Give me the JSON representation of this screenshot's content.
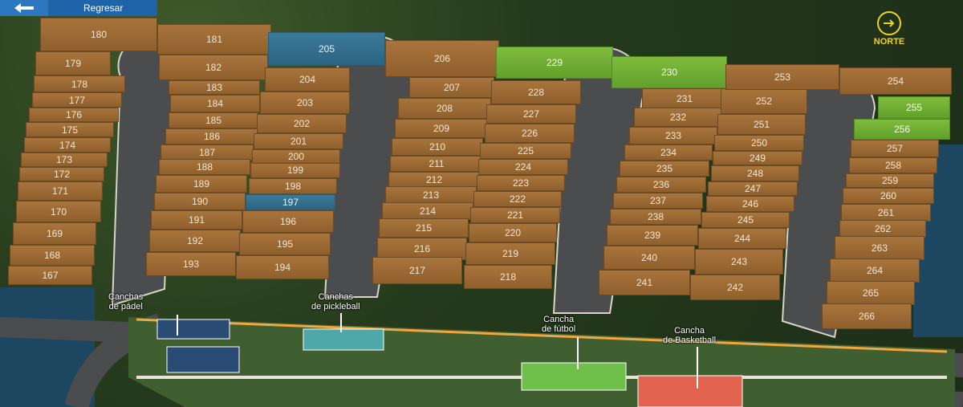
{
  "nav": {
    "back_label": "Regresar"
  },
  "compass": {
    "label": "NORTE",
    "icon": "arrow-right-icon"
  },
  "amenities": [
    {
      "id": "padel",
      "line1": "Canchas",
      "line2": "de pádel"
    },
    {
      "id": "pickleball",
      "line1": "Canchas",
      "line2": "de pickleball"
    },
    {
      "id": "futbol",
      "line1": "Cancha",
      "line2": "de fútbol"
    },
    {
      "id": "basketball",
      "line1": "Cancha",
      "line2": "de Basketball"
    }
  ],
  "lot_colors": {
    "available": "#9c6a35",
    "sold": "#3c7a99",
    "reserved": "#76b33a"
  },
  "lots": {
    "167": "sold",
    "168": "sold",
    "169": "sold",
    "170": "sold",
    "171": "sold",
    "172": "sold",
    "173": "sold",
    "174": "sold",
    "175": "sold",
    "176": "sold",
    "177": "sold",
    "178": "sold",
    "179": "sold",
    "180": "sold",
    "181": "sold",
    "182": "sold",
    "183": "sold",
    "184": "sold",
    "185": "sold",
    "186": "sold",
    "187": "sold",
    "188": "sold",
    "189": "sold",
    "190": "sold",
    "191": "sold",
    "192": "sold",
    "193": "sold",
    "194": "sold",
    "195": "sold",
    "196": "sold",
    "197": "blue",
    "198": "sold",
    "199": "sold",
    "200": "sold",
    "201": "sold",
    "202": "sold",
    "203": "sold",
    "204": "sold",
    "205": "blue",
    "206": "sold",
    "207": "sold",
    "208": "sold",
    "209": "sold",
    "210": "sold",
    "211": "sold",
    "212": "sold",
    "213": "sold",
    "214": "sold",
    "215": "sold",
    "216": "sold",
    "217": "sold",
    "218": "sold",
    "219": "sold",
    "220": "sold",
    "221": "sold",
    "222": "sold",
    "223": "sold",
    "224": "sold",
    "225": "sold",
    "226": "sold",
    "227": "sold",
    "228": "sold",
    "229": "green",
    "230": "green",
    "231": "sold",
    "232": "sold",
    "233": "sold",
    "234": "sold",
    "235": "sold",
    "236": "sold",
    "237": "sold",
    "238": "sold",
    "239": "sold",
    "240": "sold",
    "241": "sold",
    "242": "sold",
    "243": "sold",
    "244": "sold",
    "245": "sold",
    "246": "sold",
    "247": "sold",
    "248": "sold",
    "249": "sold",
    "250": "sold",
    "251": "sold",
    "252": "sold",
    "253": "sold",
    "254": "sold",
    "255": "green",
    "256": "green",
    "257": "sold",
    "258": "sold",
    "259": "sold",
    "260": "sold",
    "261": "sold",
    "262": "sold",
    "263": "sold",
    "264": "sold",
    "265": "sold",
    "266": "sold"
  }
}
